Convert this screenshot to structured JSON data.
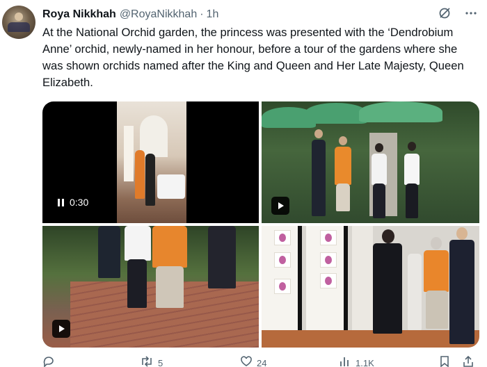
{
  "author": {
    "name": "Roya Nikkhah",
    "handle": "@RoyaNikkhah",
    "separator": "·",
    "time": "1h"
  },
  "tweet": {
    "text": "At the National Orchid garden, the princess was presented with the ‘Dendrobium Anne’ orchid, newly-named in her honour, before a tour of the gardens where she was shown orchids named after the King and Queen and Her Late Majesty, Queen Elizabeth."
  },
  "header_icons": [
    "grok-icon",
    "more-icon"
  ],
  "media": {
    "video1": {
      "duration": "0:30",
      "state": "pause-icon"
    },
    "video2": {
      "state": "play-icon"
    },
    "video3": {
      "state": "play-icon"
    }
  },
  "actions": {
    "reply": {
      "icon": "reply-icon",
      "count": ""
    },
    "retweet": {
      "icon": "retweet-icon",
      "count": "5"
    },
    "like": {
      "icon": "heart-icon",
      "count": "24"
    },
    "views": {
      "icon": "views-icon",
      "count": "1.1K"
    },
    "bookmark": {
      "icon": "bookmark-icon"
    },
    "share": {
      "icon": "share-icon"
    }
  }
}
